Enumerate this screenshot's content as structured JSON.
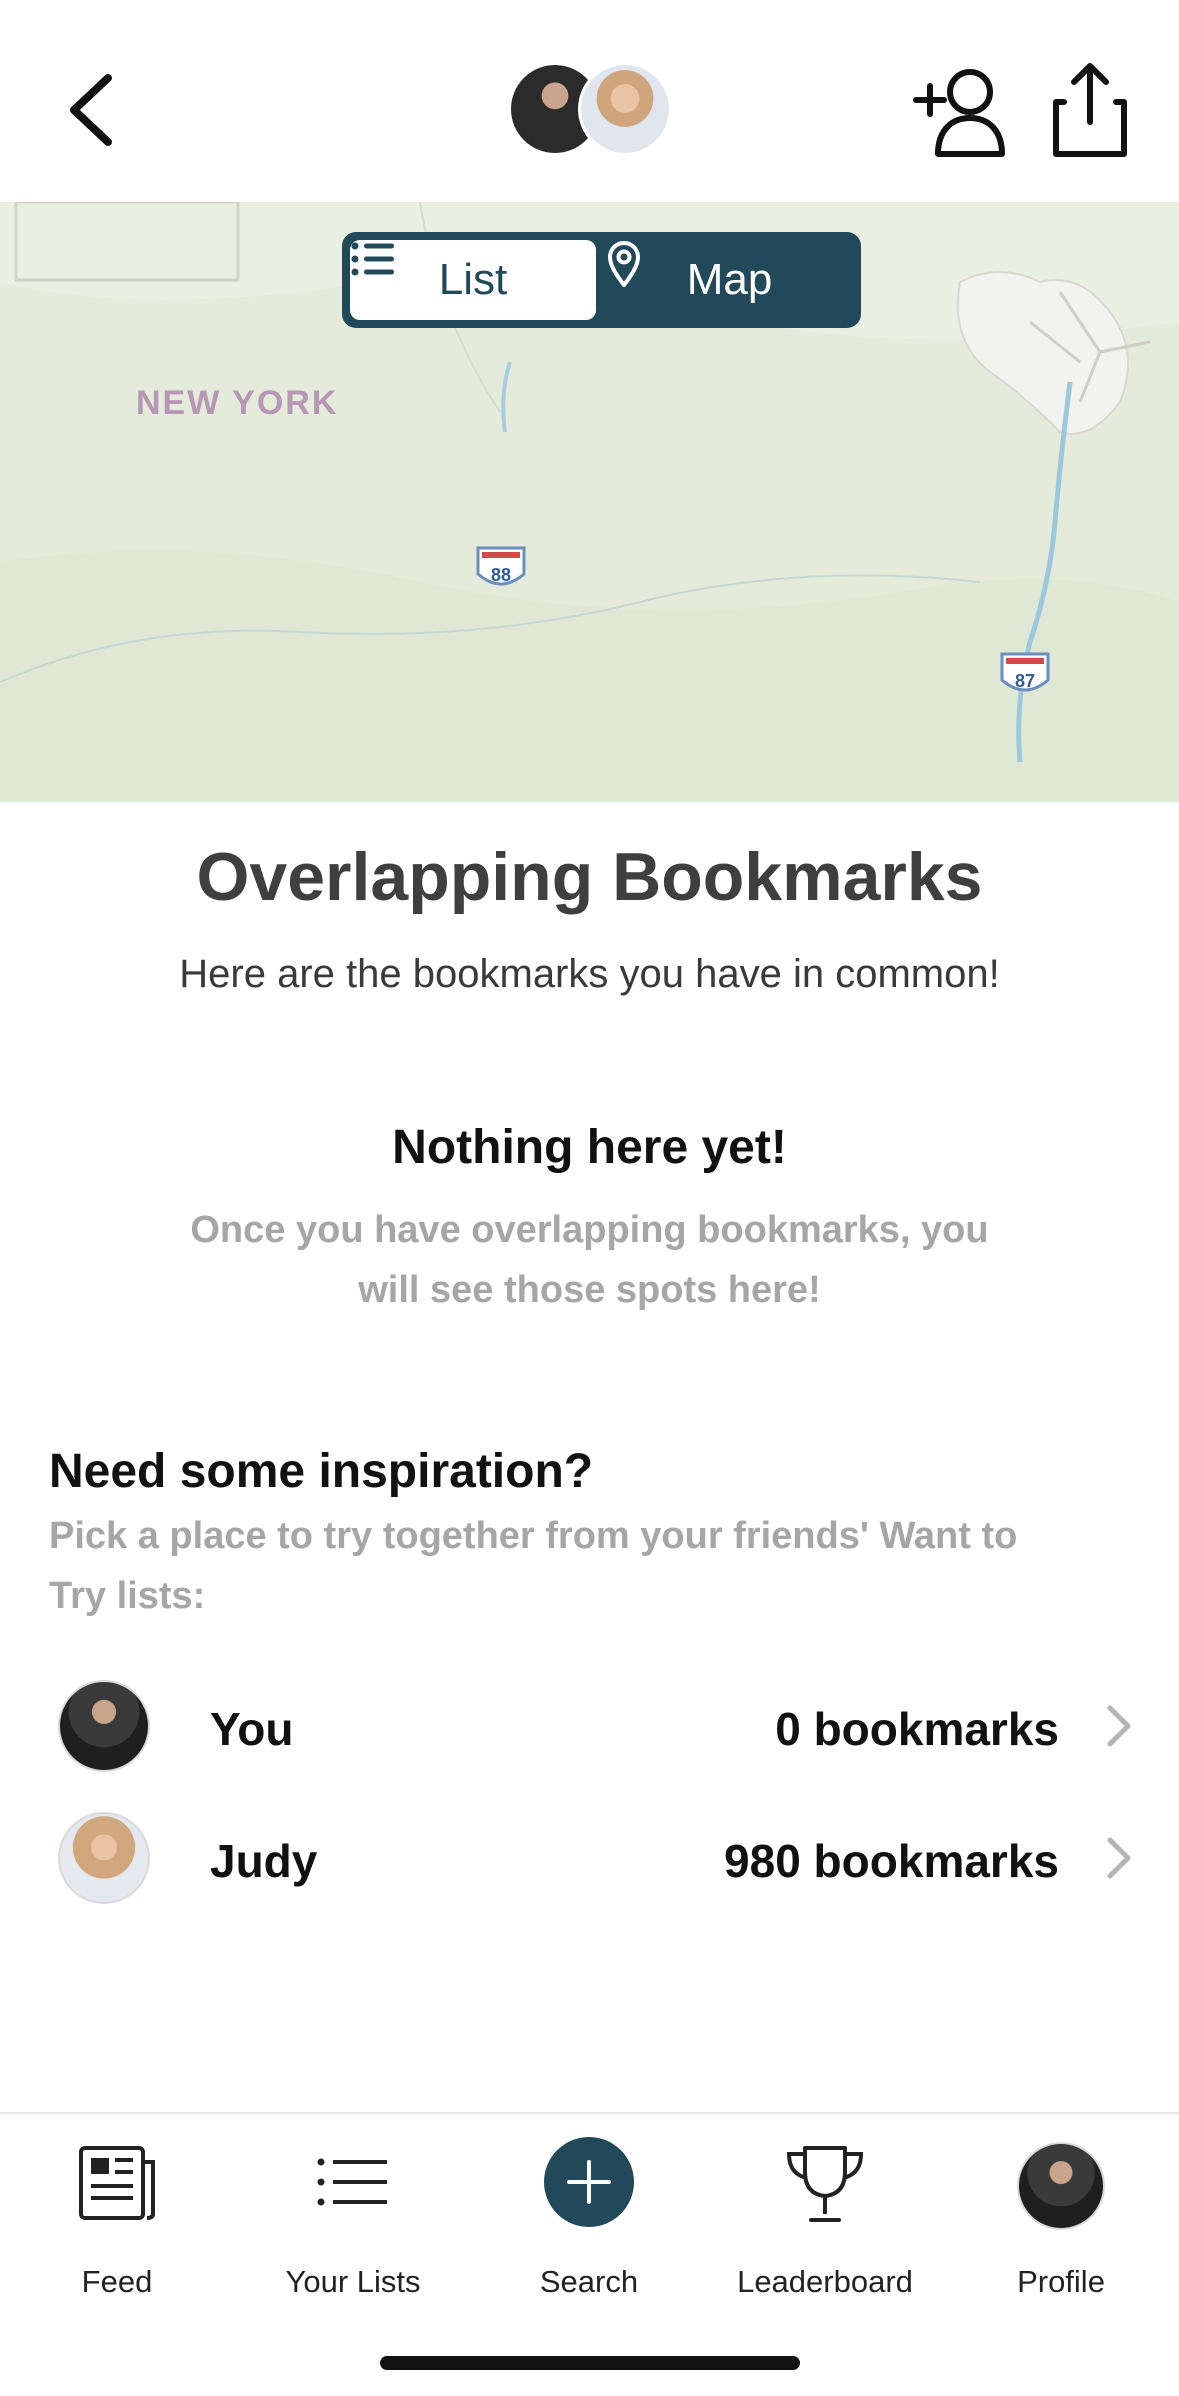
{
  "map": {
    "region_label": "NEW YORK",
    "shields": [
      "88",
      "87"
    ],
    "toggle": {
      "list_label": "List",
      "map_label": "Map",
      "selected": "List"
    }
  },
  "main": {
    "title": "Overlapping Bookmarks",
    "subtitle": "Here are the bookmarks you have in common!",
    "empty_title": "Nothing here yet!",
    "empty_text": "Once you have overlapping bookmarks, you will see those spots here!",
    "inspiration_title": "Need some inspiration?",
    "inspiration_text": "Pick a place to try together from your friends' Want to Try lists:"
  },
  "friends": [
    {
      "name": "You",
      "count": "0 bookmarks"
    },
    {
      "name": "Judy",
      "count": "980 bookmarks"
    }
  ],
  "tabs": [
    {
      "label": "Feed",
      "icon": "newspaper-icon"
    },
    {
      "label": "Your Lists",
      "icon": "list-icon"
    },
    {
      "label": "Search",
      "icon": "plus-icon"
    },
    {
      "label": "Leaderboard",
      "icon": "trophy-icon"
    },
    {
      "label": "Profile",
      "icon": "avatar"
    }
  ],
  "colors": {
    "accent": "#22495a",
    "muted_text": "#a6a6a6",
    "map_bg": "#e6ecdc",
    "map_label": "#b896b6"
  }
}
